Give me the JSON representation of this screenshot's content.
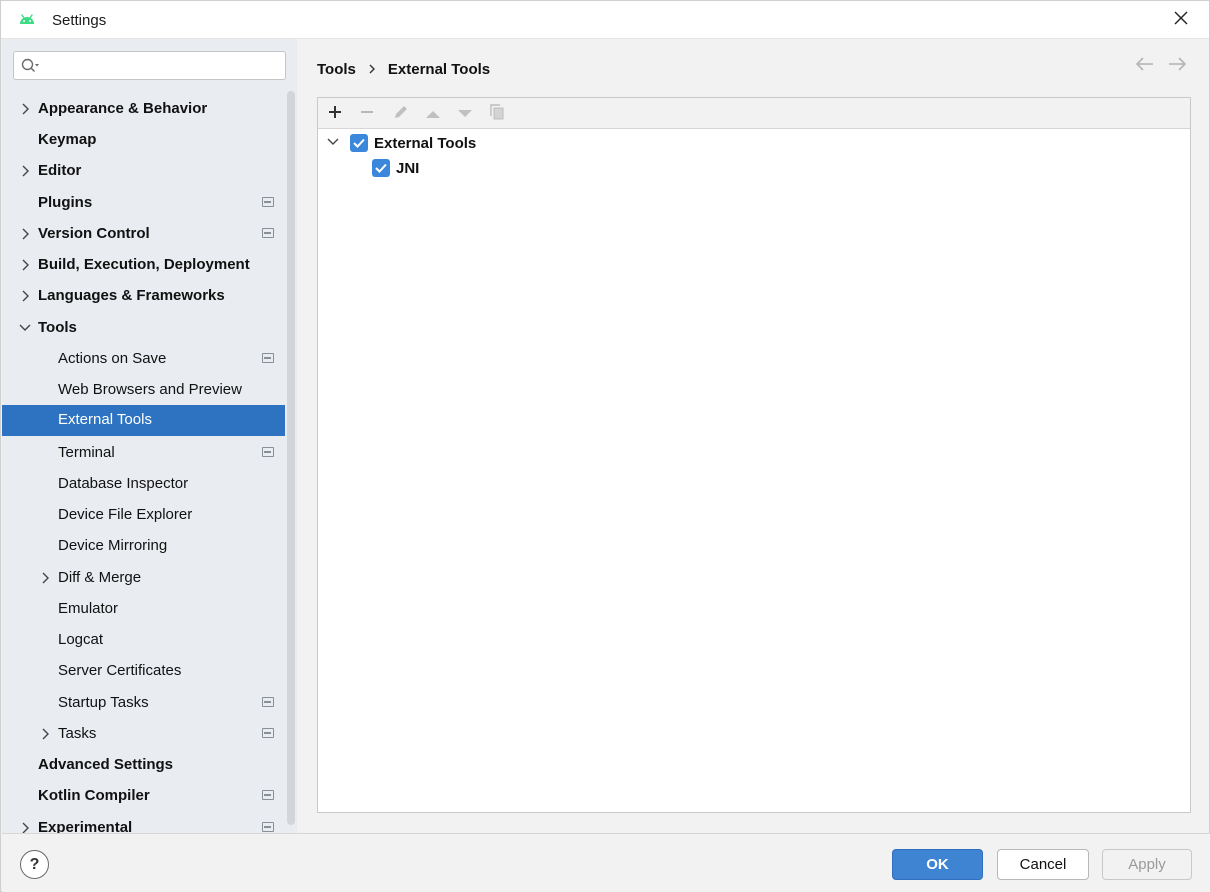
{
  "window": {
    "title": "Settings",
    "app_icon": "android-icon",
    "accent_color": "#2d73c1"
  },
  "sidebar": {
    "search": {
      "value": "",
      "placeholder": ""
    },
    "items": [
      {
        "label": "Appearance & Behavior",
        "bold": true,
        "expandable": true,
        "expanded": false,
        "level": 0,
        "project_icon": false
      },
      {
        "label": "Keymap",
        "bold": true,
        "expandable": false,
        "level": 0,
        "project_icon": false
      },
      {
        "label": "Editor",
        "bold": true,
        "expandable": true,
        "expanded": false,
        "level": 0,
        "project_icon": false
      },
      {
        "label": "Plugins",
        "bold": true,
        "expandable": false,
        "level": 0,
        "project_icon": true
      },
      {
        "label": "Version Control",
        "bold": true,
        "expandable": true,
        "expanded": false,
        "level": 0,
        "project_icon": true
      },
      {
        "label": "Build, Execution, Deployment",
        "bold": true,
        "expandable": true,
        "expanded": false,
        "level": 0,
        "project_icon": false
      },
      {
        "label": "Languages & Frameworks",
        "bold": true,
        "expandable": true,
        "expanded": false,
        "level": 0,
        "project_icon": false
      },
      {
        "label": "Tools",
        "bold": true,
        "expandable": true,
        "expanded": true,
        "level": 0,
        "project_icon": false
      },
      {
        "label": "Actions on Save",
        "bold": false,
        "expandable": false,
        "level": 1,
        "project_icon": true
      },
      {
        "label": "Web Browsers and Preview",
        "bold": false,
        "expandable": false,
        "level": 1,
        "project_icon": false
      },
      {
        "label": "External Tools",
        "bold": false,
        "expandable": false,
        "level": 1,
        "project_icon": false,
        "selected": true
      },
      {
        "label": "Terminal",
        "bold": false,
        "expandable": false,
        "level": 1,
        "project_icon": true
      },
      {
        "label": "Database Inspector",
        "bold": false,
        "expandable": false,
        "level": 1,
        "project_icon": false
      },
      {
        "label": "Device File Explorer",
        "bold": false,
        "expandable": false,
        "level": 1,
        "project_icon": false
      },
      {
        "label": "Device Mirroring",
        "bold": false,
        "expandable": false,
        "level": 1,
        "project_icon": false
      },
      {
        "label": "Diff & Merge",
        "bold": false,
        "expandable": true,
        "expanded": false,
        "level": 1,
        "project_icon": false
      },
      {
        "label": "Emulator",
        "bold": false,
        "expandable": false,
        "level": 1,
        "project_icon": false
      },
      {
        "label": "Logcat",
        "bold": false,
        "expandable": false,
        "level": 1,
        "project_icon": false
      },
      {
        "label": "Server Certificates",
        "bold": false,
        "expandable": false,
        "level": 1,
        "project_icon": false
      },
      {
        "label": "Startup Tasks",
        "bold": false,
        "expandable": false,
        "level": 1,
        "project_icon": true
      },
      {
        "label": "Tasks",
        "bold": false,
        "expandable": true,
        "expanded": false,
        "level": 1,
        "project_icon": true
      },
      {
        "label": "Advanced Settings",
        "bold": true,
        "expandable": false,
        "level": 0,
        "project_icon": false
      },
      {
        "label": "Kotlin Compiler",
        "bold": true,
        "expandable": false,
        "level": 0,
        "project_icon": true
      },
      {
        "label": "Experimental",
        "bold": true,
        "expandable": true,
        "expanded": false,
        "level": 0,
        "project_icon": true
      }
    ]
  },
  "breadcrumb": {
    "parent": "Tools",
    "current": "External Tools"
  },
  "toolbar": {
    "buttons": [
      {
        "name": "add-icon",
        "enabled": true
      },
      {
        "name": "remove-icon",
        "enabled": false
      },
      {
        "name": "edit-icon",
        "enabled": false
      },
      {
        "name": "move-up-icon",
        "enabled": false
      },
      {
        "name": "move-down-icon",
        "enabled": false
      },
      {
        "name": "copy-icon",
        "enabled": false
      }
    ]
  },
  "tools_tree": {
    "group": {
      "label": "External Tools",
      "checked": true,
      "expanded": true
    },
    "children": [
      {
        "label": "JNI",
        "checked": true
      }
    ]
  },
  "footer": {
    "help_label": "?",
    "ok_label": "OK",
    "cancel_label": "Cancel",
    "apply_label": "Apply",
    "apply_enabled": false
  }
}
